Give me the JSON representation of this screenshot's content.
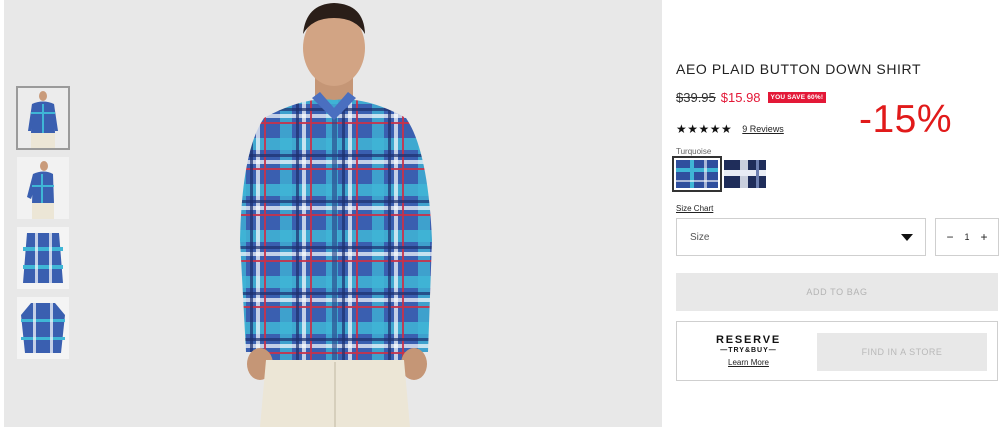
{
  "product": {
    "title": "AEO PLAID BUTTON DOWN SHIRT",
    "old_price": "$39.95",
    "new_price": "$15.98",
    "save_badge": "YOU SAVE 60%!",
    "discount_overlay": "-15%",
    "stars": "★★★★★",
    "rating": 5,
    "reviews_link": "9 Reviews",
    "color_label": "Turquoise",
    "swatches": [
      {
        "name": "Turquoise",
        "selected": true
      },
      {
        "name": "Navy/White",
        "selected": false
      }
    ]
  },
  "size": {
    "chart_link": "Size Chart",
    "select_label": "Size"
  },
  "quantity": {
    "minus": "−",
    "value": "1",
    "plus": "+"
  },
  "actions": {
    "add_to_bag": "ADD TO BAG",
    "find_in_store": "FIND IN A STORE"
  },
  "reserve": {
    "line1": "RESERVE",
    "line2": "—TRY&BUY—",
    "learn_more": "Learn More"
  },
  "gallery": {
    "thumbnails": [
      "front-view",
      "three-quarter-view",
      "folded-view",
      "flat-lay-view"
    ],
    "active_index": 0
  },
  "colors": {
    "sale_red": "#e31837",
    "overlay_red": "#e11a1a",
    "plaid_blue": "#2f4f9e",
    "plaid_turquoise": "#3fb6d6"
  }
}
